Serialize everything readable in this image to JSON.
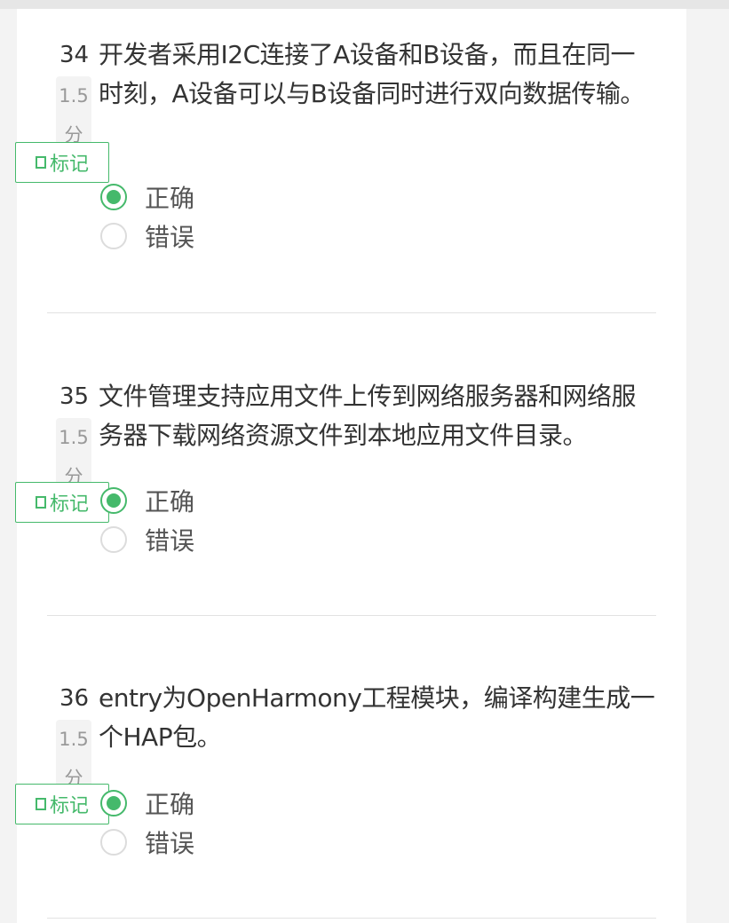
{
  "questions": [
    {
      "number": "34",
      "score_num": "1.5",
      "score_unit": "分",
      "text": "开发者采用I2C连接了A设备和B设备，而且在同一时刻，A设备可以与B设备同时进行双向数据传输。",
      "mark_label": "标记",
      "options": [
        {
          "label": "正确",
          "checked": true
        },
        {
          "label": "错误",
          "checked": false
        }
      ]
    },
    {
      "number": "35",
      "score_num": "1.5",
      "score_unit": "分",
      "text": "文件管理支持应用文件上传到网络服务器和网络服务器下载网络资源文件到本地应用文件目录。",
      "mark_label": "标记",
      "options": [
        {
          "label": "正确",
          "checked": true
        },
        {
          "label": "错误",
          "checked": false
        }
      ]
    },
    {
      "number": "36",
      "score_num": "1.5",
      "score_unit": "分",
      "text": "entry为OpenHarmony工程模块，编译构建生成一个HAP包。",
      "mark_label": "标记",
      "options": [
        {
          "label": "正确",
          "checked": true
        },
        {
          "label": "错误",
          "checked": false
        }
      ]
    }
  ],
  "colors": {
    "accent": "#45b96b",
    "text": "#333333",
    "muted": "#999999"
  },
  "icons": {
    "mark": "bookmark-icon"
  }
}
